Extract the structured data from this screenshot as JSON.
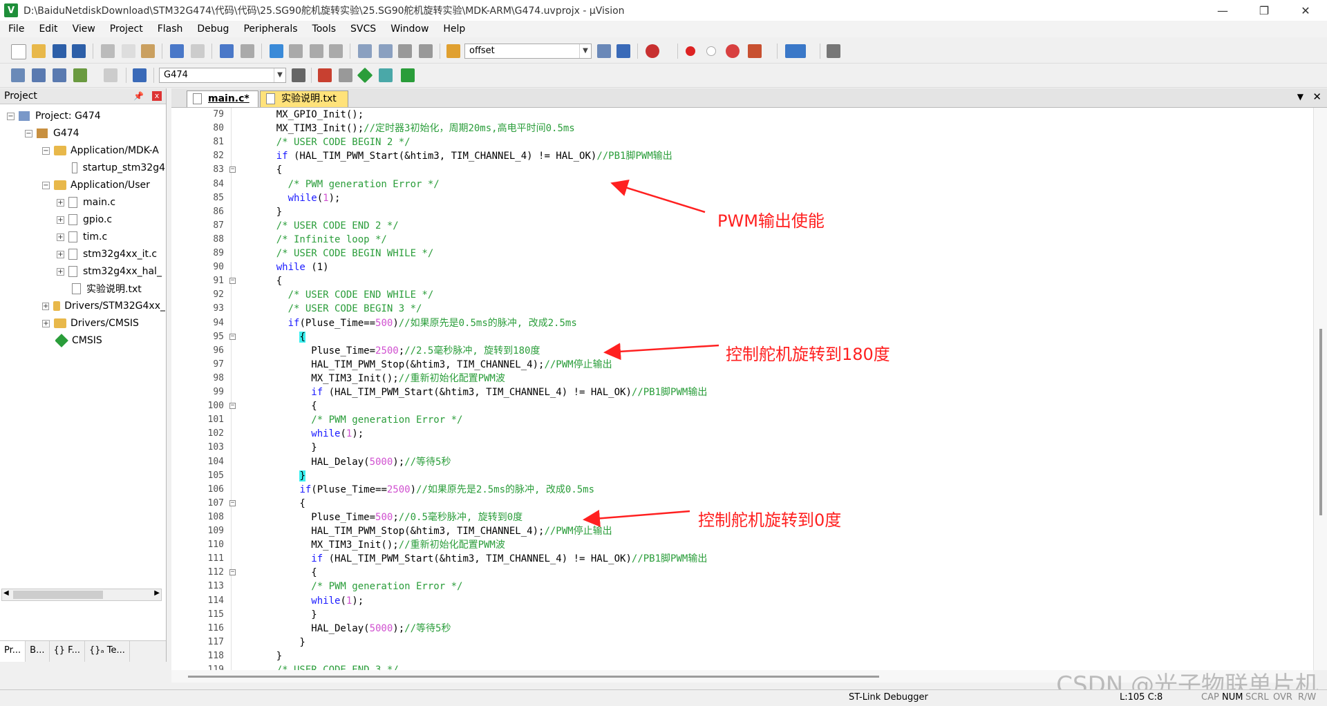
{
  "window": {
    "title": "D:\\BaiduNetdiskDownload\\STM32G474\\代码\\代码\\25.SG90舵机旋转实验\\25.SG90舵机旋转实验\\MDK-ARM\\G474.uvprojx - µVision",
    "app_icon_letter": "V",
    "minimize": "—",
    "maximize": "❐",
    "close": "✕"
  },
  "menu": [
    "File",
    "Edit",
    "View",
    "Project",
    "Flash",
    "Debug",
    "Peripherals",
    "Tools",
    "SVCS",
    "Window",
    "Help"
  ],
  "toolbar": {
    "find_combo_value": "offset",
    "target_combo_value": "G474"
  },
  "project_panel": {
    "title": "Project",
    "pin": "📌",
    "close": "x",
    "tree": [
      {
        "label": "Project: G474",
        "expander": "−",
        "icon": "project-icon"
      },
      {
        "label": "G474",
        "expander": "−",
        "icon": "target-icon"
      },
      {
        "label": "Application/MDK-A",
        "expander": "−",
        "icon": "folder-icon"
      },
      {
        "label": "startup_stm32g4",
        "icon": "file-icon"
      },
      {
        "label": "Application/User",
        "expander": "−",
        "icon": "folder-icon"
      },
      {
        "label": "main.c",
        "expander": "+",
        "icon": "file-icon"
      },
      {
        "label": "gpio.c",
        "expander": "+",
        "icon": "file-icon"
      },
      {
        "label": "tim.c",
        "expander": "+",
        "icon": "file-icon"
      },
      {
        "label": "stm32g4xx_it.c",
        "expander": "+",
        "icon": "file-icon"
      },
      {
        "label": "stm32g4xx_hal_",
        "expander": "+",
        "icon": "file-icon"
      },
      {
        "label": "实验说明.txt",
        "icon": "file-icon"
      },
      {
        "label": "Drivers/STM32G4xx_",
        "expander": "+",
        "icon": "folder-icon"
      },
      {
        "label": "Drivers/CMSIS",
        "expander": "+",
        "icon": "folder-icon"
      },
      {
        "label": "CMSIS",
        "icon": "component-icon"
      }
    ],
    "bottom_tabs": [
      "Pr...",
      "B...",
      "{} F...",
      "{}ₐ Te..."
    ]
  },
  "editor": {
    "tabs": [
      {
        "label": "main.c*",
        "active": true
      },
      {
        "label": "实验说明.txt",
        "active": false
      }
    ],
    "tab_menu": "▼",
    "tab_close": "✕",
    "lines": [
      {
        "n": "79",
        "fold": false,
        "segs": [
          {
            "t": "    MX_GPIO_Init();",
            "c": "txt"
          }
        ]
      },
      {
        "n": "80",
        "fold": false,
        "segs": [
          {
            "t": "    MX_TIM3_Init();",
            "c": "txt"
          },
          {
            "t": "//定时器3初始化，周期20ms,高电平时间0.5ms",
            "c": "cm"
          }
        ]
      },
      {
        "n": "81",
        "fold": false,
        "segs": [
          {
            "t": "    /* USER CODE BEGIN 2 */",
            "c": "cm"
          }
        ]
      },
      {
        "n": "82",
        "fold": false,
        "segs": [
          {
            "t": "    ",
            "c": "txt"
          },
          {
            "t": "if",
            "c": "kw"
          },
          {
            "t": " (HAL_TIM_PWM_Start(&htim3, TIM_CHANNEL_4) != HAL_OK)",
            "c": "txt"
          },
          {
            "t": "//PB1脚PWM输出",
            "c": "cm"
          }
        ]
      },
      {
        "n": "83",
        "fold": true,
        "segs": [
          {
            "t": "    {",
            "c": "txt"
          }
        ]
      },
      {
        "n": "84",
        "fold": false,
        "segs": [
          {
            "t": "      /* PWM generation Error */",
            "c": "cm"
          }
        ]
      },
      {
        "n": "85",
        "fold": false,
        "segs": [
          {
            "t": "      ",
            "c": "txt"
          },
          {
            "t": "while",
            "c": "kw"
          },
          {
            "t": "(",
            "c": "txt"
          },
          {
            "t": "1",
            "c": "num"
          },
          {
            "t": ");",
            "c": "txt"
          }
        ]
      },
      {
        "n": "86",
        "fold": false,
        "segs": [
          {
            "t": "    }",
            "c": "txt"
          }
        ]
      },
      {
        "n": "87",
        "fold": false,
        "segs": [
          {
            "t": "    /* USER CODE END 2 */",
            "c": "cm"
          }
        ]
      },
      {
        "n": "88",
        "fold": false,
        "segs": [
          {
            "t": "    /* Infinite loop */",
            "c": "cm"
          }
        ]
      },
      {
        "n": "89",
        "fold": false,
        "segs": [
          {
            "t": "    /* USER CODE BEGIN WHILE */",
            "c": "cm"
          }
        ]
      },
      {
        "n": "90",
        "fold": false,
        "segs": [
          {
            "t": "    ",
            "c": "txt"
          },
          {
            "t": "while",
            "c": "kw"
          },
          {
            "t": " (1)",
            "c": "txt"
          }
        ]
      },
      {
        "n": "91",
        "fold": true,
        "segs": [
          {
            "t": "    {",
            "c": "txt"
          }
        ]
      },
      {
        "n": "92",
        "fold": false,
        "segs": [
          {
            "t": "      /* USER CODE END WHILE */",
            "c": "cm"
          }
        ]
      },
      {
        "n": "93",
        "fold": false,
        "segs": [
          {
            "t": "      /* USER CODE BEGIN 3 */",
            "c": "cm"
          }
        ]
      },
      {
        "n": "94",
        "fold": false,
        "segs": [
          {
            "t": "      ",
            "c": "txt"
          },
          {
            "t": "if",
            "c": "kw"
          },
          {
            "t": "(Pluse_Time==",
            "c": "txt"
          },
          {
            "t": "500",
            "c": "num"
          },
          {
            "t": ")",
            "c": "txt"
          },
          {
            "t": "//如果原先是0.5ms的脉冲, 改成2.5ms",
            "c": "cm"
          }
        ]
      },
      {
        "n": "95",
        "fold": true,
        "segs": [
          {
            "t": "        ",
            "c": "txt"
          },
          {
            "t": "{",
            "c": "hl"
          }
        ]
      },
      {
        "n": "96",
        "fold": false,
        "segs": [
          {
            "t": "          Pluse_Time=",
            "c": "txt"
          },
          {
            "t": "2500",
            "c": "num"
          },
          {
            "t": ";",
            "c": "txt"
          },
          {
            "t": "//2.5毫秒脉冲, 旋转到180度",
            "c": "cm"
          }
        ]
      },
      {
        "n": "97",
        "fold": false,
        "segs": [
          {
            "t": "          HAL_TIM_PWM_Stop(&htim3, TIM_CHANNEL_4);",
            "c": "txt"
          },
          {
            "t": "//PWM停止输出",
            "c": "cm"
          }
        ]
      },
      {
        "n": "98",
        "fold": false,
        "segs": [
          {
            "t": "          MX_TIM3_Init();",
            "c": "txt"
          },
          {
            "t": "//重新初始化配置PWM波",
            "c": "cm"
          }
        ]
      },
      {
        "n": "99",
        "fold": false,
        "segs": [
          {
            "t": "          ",
            "c": "txt"
          },
          {
            "t": "if",
            "c": "kw"
          },
          {
            "t": " (HAL_TIM_PWM_Start(&htim3, TIM_CHANNEL_4) != HAL_OK)",
            "c": "txt"
          },
          {
            "t": "//PB1脚PWM输出",
            "c": "cm"
          }
        ]
      },
      {
        "n": "100",
        "fold": true,
        "segs": [
          {
            "t": "          {",
            "c": "txt"
          }
        ]
      },
      {
        "n": "101",
        "fold": false,
        "segs": [
          {
            "t": "          /* PWM generation Error */",
            "c": "cm"
          }
        ]
      },
      {
        "n": "102",
        "fold": false,
        "segs": [
          {
            "t": "          ",
            "c": "txt"
          },
          {
            "t": "while",
            "c": "kw"
          },
          {
            "t": "(",
            "c": "txt"
          },
          {
            "t": "1",
            "c": "num"
          },
          {
            "t": ");",
            "c": "txt"
          }
        ]
      },
      {
        "n": "103",
        "fold": false,
        "segs": [
          {
            "t": "          }",
            "c": "txt"
          }
        ]
      },
      {
        "n": "104",
        "fold": false,
        "segs": [
          {
            "t": "          HAL_Delay(",
            "c": "txt"
          },
          {
            "t": "5000",
            "c": "num"
          },
          {
            "t": ");",
            "c": "txt"
          },
          {
            "t": "//等待5秒",
            "c": "cm"
          }
        ]
      },
      {
        "n": "105",
        "fold": false,
        "segs": [
          {
            "t": "        ",
            "c": "txt"
          },
          {
            "t": "}",
            "c": "hl"
          }
        ]
      },
      {
        "n": "106",
        "fold": false,
        "segs": [
          {
            "t": "        ",
            "c": "txt"
          },
          {
            "t": "if",
            "c": "kw"
          },
          {
            "t": "(Pluse_Time==",
            "c": "txt"
          },
          {
            "t": "2500",
            "c": "num"
          },
          {
            "t": ")",
            "c": "txt"
          },
          {
            "t": "//如果原先是2.5ms的脉冲, 改成0.5ms",
            "c": "cm"
          }
        ]
      },
      {
        "n": "107",
        "fold": true,
        "segs": [
          {
            "t": "        {",
            "c": "txt"
          }
        ]
      },
      {
        "n": "108",
        "fold": false,
        "segs": [
          {
            "t": "          Pluse_Time=",
            "c": "txt"
          },
          {
            "t": "500",
            "c": "num"
          },
          {
            "t": ";",
            "c": "txt"
          },
          {
            "t": "//0.5毫秒脉冲, 旋转到0度",
            "c": "cm"
          }
        ]
      },
      {
        "n": "109",
        "fold": false,
        "segs": [
          {
            "t": "          HAL_TIM_PWM_Stop(&htim3, TIM_CHANNEL_4);",
            "c": "txt"
          },
          {
            "t": "//PWM停止输出",
            "c": "cm"
          }
        ]
      },
      {
        "n": "110",
        "fold": false,
        "segs": [
          {
            "t": "          MX_TIM3_Init();",
            "c": "txt"
          },
          {
            "t": "//重新初始化配置PWM波",
            "c": "cm"
          }
        ]
      },
      {
        "n": "111",
        "fold": false,
        "segs": [
          {
            "t": "          ",
            "c": "txt"
          },
          {
            "t": "if",
            "c": "kw"
          },
          {
            "t": " (HAL_TIM_PWM_Start(&htim3, TIM_CHANNEL_4) != HAL_OK)",
            "c": "txt"
          },
          {
            "t": "//PB1脚PWM输出",
            "c": "cm"
          }
        ]
      },
      {
        "n": "112",
        "fold": true,
        "segs": [
          {
            "t": "          {",
            "c": "txt"
          }
        ]
      },
      {
        "n": "113",
        "fold": false,
        "segs": [
          {
            "t": "          /* PWM generation Error */",
            "c": "cm"
          }
        ]
      },
      {
        "n": "114",
        "fold": false,
        "segs": [
          {
            "t": "          ",
            "c": "txt"
          },
          {
            "t": "while",
            "c": "kw"
          },
          {
            "t": "(",
            "c": "txt"
          },
          {
            "t": "1",
            "c": "num"
          },
          {
            "t": ");",
            "c": "txt"
          }
        ]
      },
      {
        "n": "115",
        "fold": false,
        "segs": [
          {
            "t": "          }",
            "c": "txt"
          }
        ]
      },
      {
        "n": "116",
        "fold": false,
        "segs": [
          {
            "t": "          HAL_Delay(",
            "c": "txt"
          },
          {
            "t": "5000",
            "c": "num"
          },
          {
            "t": ");",
            "c": "txt"
          },
          {
            "t": "//等待5秒",
            "c": "cm"
          }
        ]
      },
      {
        "n": "117",
        "fold": false,
        "segs": [
          {
            "t": "        }",
            "c": "txt"
          }
        ]
      },
      {
        "n": "118",
        "fold": false,
        "segs": [
          {
            "t": "    }",
            "c": "txt"
          }
        ]
      },
      {
        "n": "119",
        "fold": false,
        "segs": [
          {
            "t": "    /* USER CODE END 3 */",
            "c": "cm"
          }
        ]
      }
    ]
  },
  "annotations": [
    "PWM输出使能",
    "控制舵机旋转到180度",
    "控制舵机旋转到0度"
  ],
  "colors": {
    "comment": "#2a9d3a",
    "keyword": "#1a1aff",
    "number": "#d050d0",
    "annotation": "#ff2020",
    "brace_highlight": "#3af0f0"
  },
  "status": {
    "debugger": "ST-Link Debugger",
    "cursor": "L:105 C:8",
    "caps": "CAP",
    "num": "NUM",
    "scroll": "SCRL",
    "ovr": "OVR",
    "rw": "R/W"
  },
  "watermark": "CSDN @光子物联单片机"
}
